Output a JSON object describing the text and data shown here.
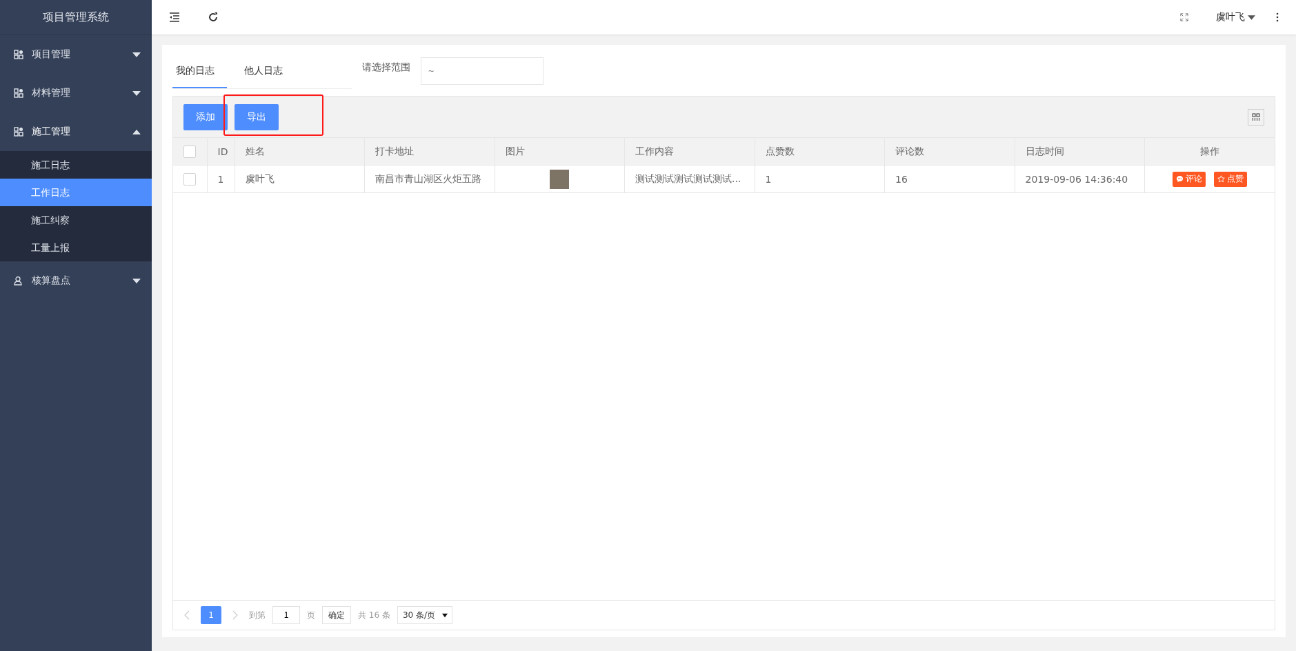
{
  "sidebar": {
    "title": "项目管理系统",
    "menus": [
      {
        "label": "项目管理",
        "kind": "grid",
        "expanded": false
      },
      {
        "label": "材料管理",
        "kind": "grid",
        "expanded": false
      },
      {
        "label": "施工管理",
        "kind": "grid",
        "expanded": true,
        "children": [
          {
            "label": "施工日志",
            "selected": false
          },
          {
            "label": "工作日志",
            "selected": true
          },
          {
            "label": "施工纠察",
            "selected": false
          },
          {
            "label": "工量上报",
            "selected": false
          }
        ]
      },
      {
        "label": "核算盘点",
        "kind": "user",
        "expanded": false
      }
    ]
  },
  "header": {
    "user": "虞叶飞"
  },
  "tabs": [
    {
      "label": "我的日志",
      "selected": true
    },
    {
      "label": "他人日志",
      "selected": false
    }
  ],
  "range": {
    "label": "请选择范围",
    "placeholder": "~"
  },
  "toolbar": {
    "buttons": [
      "添加",
      "导出"
    ],
    "highlight": true
  },
  "table": {
    "header_checked": false,
    "columns": [
      "ID",
      "姓名",
      "打卡地址",
      "图片",
      "工作内容",
      "点赞数",
      "评论数",
      "日志时间",
      "操作"
    ],
    "rows": [
      {
        "checked": false,
        "id": "1",
        "name": "虞叶飞",
        "address": "南昌市青山湖区火炬五路",
        "content": "测试测试测试测试测试...",
        "likes": "1",
        "comments": "16",
        "time": "2019-09-06 14:36:40",
        "actions": [
          {
            "label": "评论",
            "kind": "comment"
          },
          {
            "label": "点赞",
            "kind": "like"
          }
        ]
      }
    ]
  },
  "pagination": {
    "pages": [
      {
        "label": "1",
        "selected": true
      }
    ],
    "goto_label": "到第",
    "goto_value": "1",
    "page_unit": "页",
    "confirm": "确定",
    "total": "共 16 条",
    "page_size": "30 条/页"
  }
}
